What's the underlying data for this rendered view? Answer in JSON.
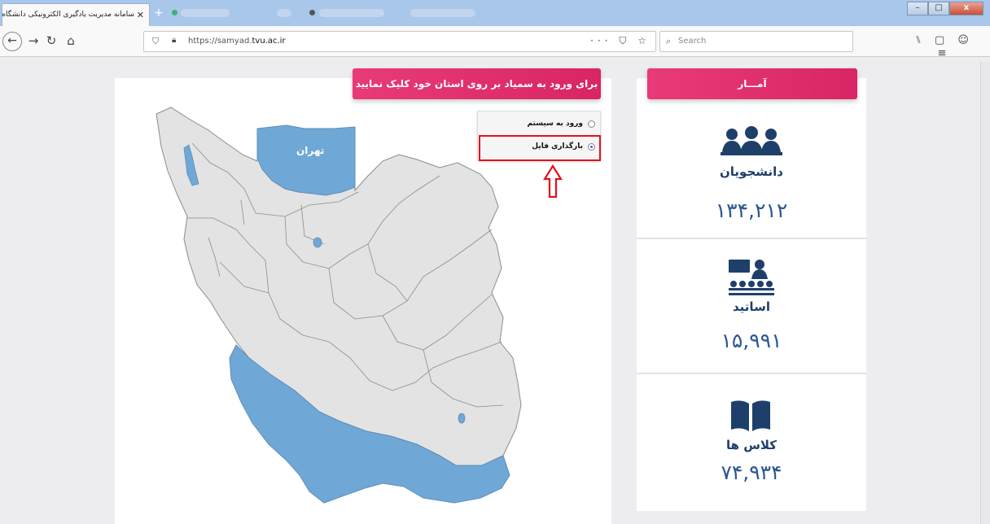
{
  "browser": {
    "active_tab_title": "سامانه مدیریت یادگیری الکترونیکی دانشگاه",
    "tab_close": "✕",
    "new_tab": "+",
    "url_prefix": "https://samyad.",
    "url_domain": "tvu.ac.ir",
    "url_actions": "··· ⛉ ☆",
    "search_placeholder": "Search",
    "toolbar_right": "⑊ ▢ ☺ ≡",
    "window_buttons": {
      "minimize": "–",
      "maximize": "□",
      "close": "x"
    }
  },
  "map_panel": {
    "title": "برای ورود به سمیاد بر روی استان خود کلیک نمایید",
    "selected_province_label": "تهران",
    "login_options": [
      {
        "label": "ورود به سیستم",
        "selected": false
      },
      {
        "label": "بارگذاری فایل",
        "selected": true
      }
    ],
    "colors": {
      "province_fill": "#e3e3e3",
      "highlight_fill": "#6fa8d6",
      "border": "#8c8c8c"
    }
  },
  "stats_panel": {
    "title": "آمـــار",
    "items": [
      {
        "icon": "students-icon",
        "label": "دانشجویان",
        "value": "۱۳۴,۲۱۲"
      },
      {
        "icon": "teachers-icon",
        "label": "اساتید",
        "value": "۱۵,۹۹۱"
      },
      {
        "icon": "book-icon",
        "label": "کلاس ها",
        "value": "۷۴,۹۳۴"
      }
    ],
    "colors": {
      "accent": "#e0306f",
      "icon": "#1f3f6b",
      "value": "#2a5792"
    }
  }
}
